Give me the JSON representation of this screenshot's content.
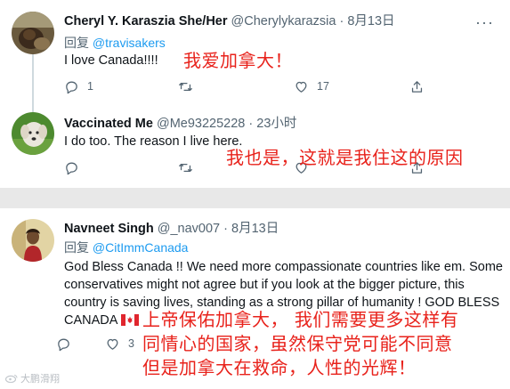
{
  "tweets": [
    {
      "name": "Cheryl Y. Karaszia She/Her",
      "handle": "@Cherylykarazsia",
      "sep": "·",
      "time": "8月13日",
      "reply_prefix": "回复 ",
      "reply_to": "@travisakers",
      "text": "I love Canada!!!!",
      "replies": "1",
      "retweets": "",
      "likes": "17",
      "translation": "我爱加拿大！"
    },
    {
      "name": "Vaccinated Me",
      "handle": "@Me93225228",
      "sep": "·",
      "time": "23小时",
      "text": "I do too.  The reason I live here.",
      "replies": "",
      "retweets": "",
      "likes": "",
      "translation": "我也是，这就是我住这的原因"
    },
    {
      "name": "Navneet Singh",
      "handle": "@_nav007",
      "sep": "·",
      "time": "8月13日",
      "reply_prefix": "回复 ",
      "reply_to": "@CitImmCanada",
      "text_lines": [
        "God Bless Canada !! We need more compassionate countries like em. Some",
        "conservatives might not agree but if you look at the bigger picture, this",
        "country is saving lives, standing as a strong pillar of humanity ! GOD BLESS",
        "CANADA"
      ],
      "flag_emoji": "canada-flag",
      "replies": "",
      "retweets": "",
      "likes": "3",
      "translation_lines": [
        "上帝保佑加拿大， 我们需要更多这样有",
        "同情心的国家，虽然保守党可能不同意",
        "但是加拿大在救命，人性的光辉！"
      ]
    }
  ],
  "watermark": "大鹏滑翔",
  "colors": {
    "text": "#0f1419",
    "secondary": "#536471",
    "link": "#1d9bf0",
    "overlay_red": "#e8221b",
    "divider": "#e8e8e8"
  },
  "icons": [
    "reply-icon",
    "retweet-icon",
    "like-icon",
    "share-icon",
    "more-icon",
    "canada-flag-icon"
  ]
}
